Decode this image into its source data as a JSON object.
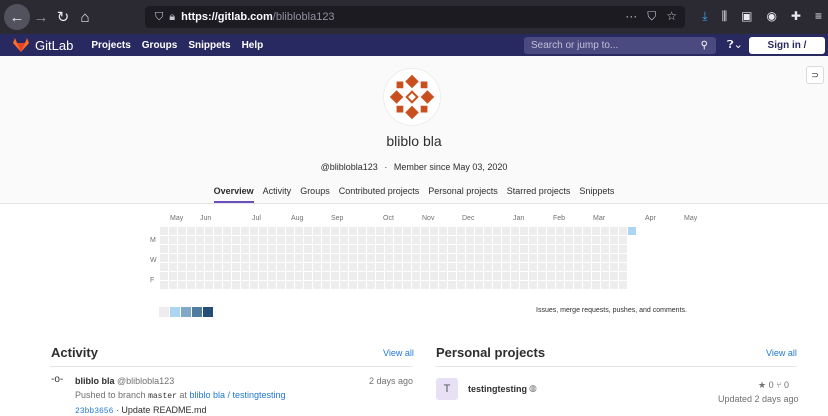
{
  "browser": {
    "url_host": "https://gitlab.com",
    "url_path": "/bliblobla123"
  },
  "navbar": {
    "brand": "GitLab",
    "menu": [
      "Projects",
      "Groups",
      "Snippets",
      "Help"
    ],
    "search_placeholder": "Search or jump to...",
    "signin": "Sign in / Register"
  },
  "profile": {
    "name": "bliblo bla",
    "handle": "@bliblobla123",
    "separator": "·",
    "member_since": "Member since May 03, 2020",
    "tabs": [
      "Overview",
      "Activity",
      "Groups",
      "Contributed projects",
      "Personal projects",
      "Starred projects",
      "Snippets"
    ],
    "active_tab": "Overview"
  },
  "calendar": {
    "months": [
      "May",
      "Jun",
      "Jul",
      "Aug",
      "Sep",
      "Oct",
      "Nov",
      "Dec",
      "Jan",
      "Feb",
      "Mar",
      "Apr",
      "May"
    ],
    "day_labels": [
      "M",
      "W",
      "F"
    ],
    "legend_text": "Issues, merge requests, pushes, and comments.",
    "legend_colors": [
      "#ededed",
      "#acd5f2",
      "#7fa8c9",
      "#527ba0",
      "#254e77"
    ],
    "empty_color": "#ededed",
    "active_color": "#acd5f2"
  },
  "activity": {
    "title": "Activity",
    "view_all": "View all",
    "item": {
      "user": "bliblo bla",
      "handle": "@bliblobla123",
      "time": "2 days ago",
      "action_prefix": "Pushed to branch",
      "branch": "master",
      "at": "at",
      "project": "bliblo bla / testingtesting",
      "commit_hash": "23bb3656",
      "commit_msg": "· Update README.md"
    }
  },
  "personal_projects": {
    "title": "Personal projects",
    "view_all": "View all",
    "project": {
      "avatar_letter": "T",
      "name": "testingtesting",
      "stars": "★ 0",
      "forks": "⑂ 0",
      "updated": "Updated 2 days ago"
    }
  }
}
